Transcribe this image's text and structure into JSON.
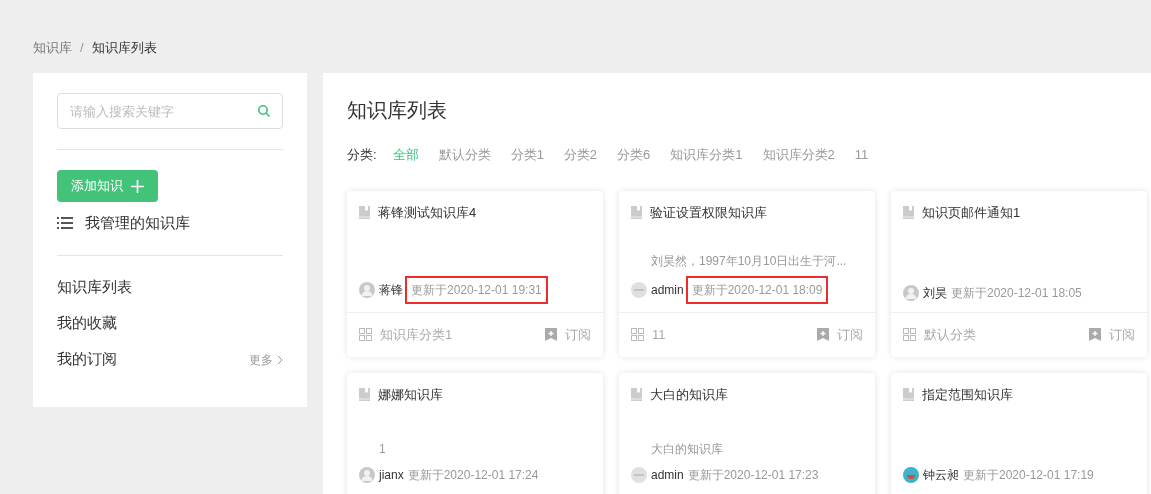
{
  "breadcrumb": {
    "items": [
      "知识库",
      "知识库列表"
    ],
    "separator": "/"
  },
  "sidebar": {
    "search": {
      "placeholder": "请输入搜索关键字"
    },
    "add_button": "添加知识",
    "managed_link": "我管理的知识库",
    "items": [
      {
        "label": "知识库列表"
      },
      {
        "label": "我的收藏"
      },
      {
        "label": "我的订阅",
        "more": "更多"
      }
    ]
  },
  "main": {
    "title": "知识库列表",
    "category_label": "分类:",
    "categories": [
      {
        "label": "全部",
        "selected": true
      },
      {
        "label": "默认分类",
        "selected": false
      },
      {
        "label": "分类1",
        "selected": false
      },
      {
        "label": "分类2",
        "selected": false
      },
      {
        "label": "分类6",
        "selected": false
      },
      {
        "label": "知识库分类1",
        "selected": false
      },
      {
        "label": "知识库分类2",
        "selected": false
      },
      {
        "label": "11",
        "selected": false
      }
    ],
    "cards": [
      {
        "title": "蒋锋测试知识库4",
        "author": "蒋锋",
        "updated": "更新于2020-12-01 19:31",
        "highlighted": true,
        "kind": "person",
        "category": "知识库分类1",
        "subscribe": "订阅"
      },
      {
        "title": "验证设置权限知识库",
        "description": "刘昊然，1997年10月10日出生于河...",
        "author": "admin",
        "updated": "更新于2020-12-01 18:09",
        "highlighted": true,
        "kind": "photo",
        "category": "11",
        "subscribe": "订阅"
      },
      {
        "title": "知识页邮件通知1",
        "author": "刘昊",
        "updated": "更新于2020-12-01 18:05",
        "highlighted": false,
        "kind": "person",
        "category": "默认分类",
        "subscribe": "订阅"
      },
      {
        "title": "娜娜知识库",
        "description": "1",
        "author": "jianx",
        "updated": "更新于2020-12-01 17:24",
        "highlighted": false,
        "kind": "person"
      },
      {
        "title": "大白的知识库",
        "description": "大白的知识库",
        "author": "admin",
        "updated": "更新于2020-12-01 17:23",
        "highlighted": false,
        "kind": "photo"
      },
      {
        "title": "指定范围知识库",
        "author": "钟云昶",
        "updated": "更新于2020-12-01 17:19",
        "highlighted": false,
        "kind": "logo"
      }
    ]
  }
}
